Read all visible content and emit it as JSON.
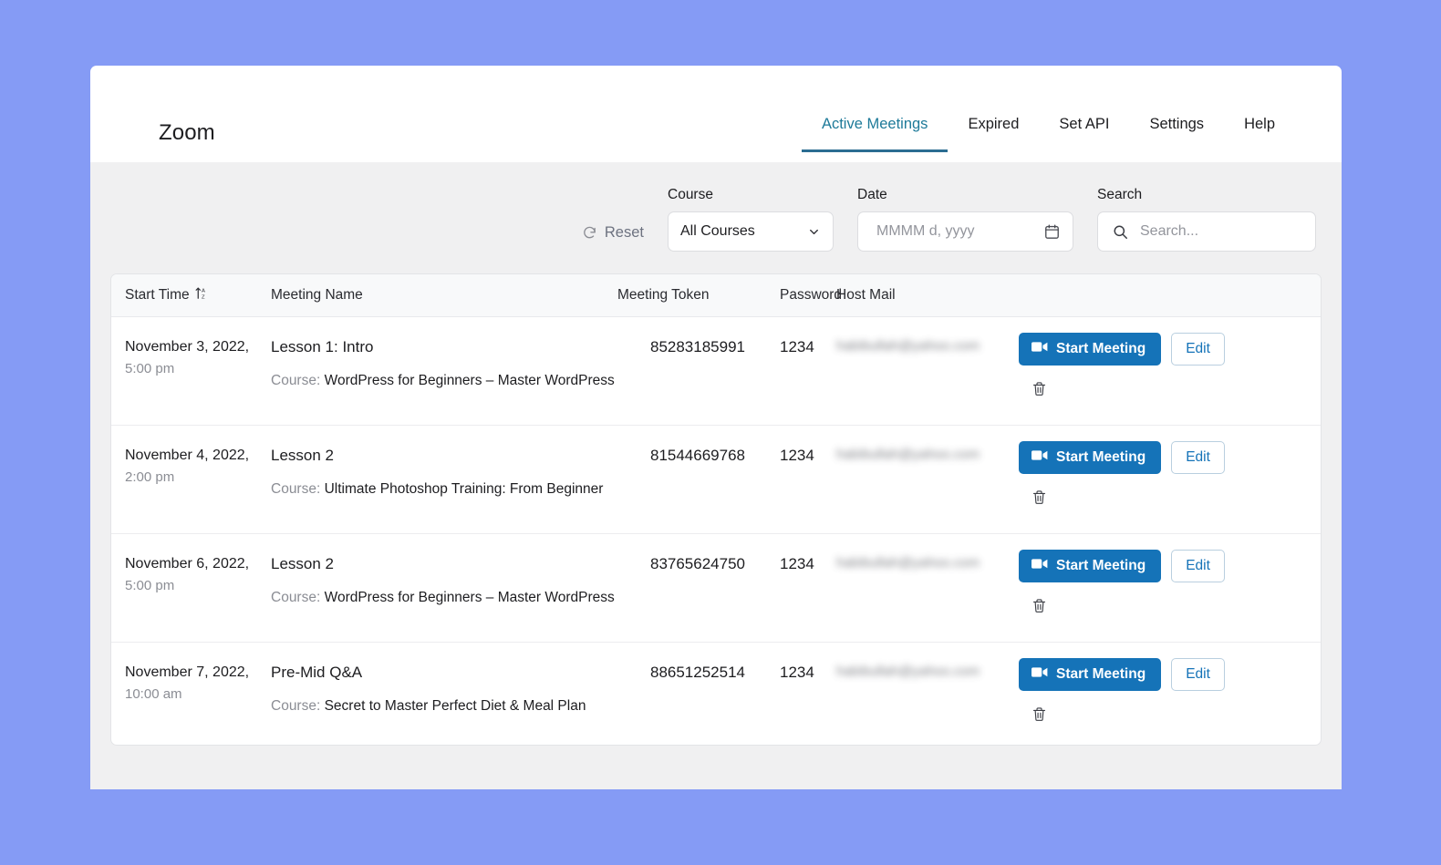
{
  "header": {
    "brand": "Zoom",
    "tabs": [
      {
        "label": "Active Meetings",
        "active": true
      },
      {
        "label": "Expired",
        "active": false
      },
      {
        "label": "Set API",
        "active": false
      },
      {
        "label": "Settings",
        "active": false
      },
      {
        "label": "Help",
        "active": false
      }
    ]
  },
  "filters": {
    "reset_label": "Reset",
    "reset_icon": "refresh-icon",
    "course": {
      "label": "Course",
      "value": "All Courses",
      "icon": "chevron-down-icon",
      "options": [
        "All Courses"
      ]
    },
    "date": {
      "label": "Date",
      "value": "",
      "placeholder": "MMMM d, yyyy",
      "icon": "calendar-icon"
    },
    "search": {
      "label": "Search",
      "value": "",
      "placeholder": "Search...",
      "icon": "search-icon"
    }
  },
  "table": {
    "columns": {
      "start_time": "Start Time",
      "meeting_name": "Meeting Name",
      "meeting_token": "Meeting Token",
      "password": "Password",
      "host_mail": "Host Mail"
    },
    "sort_icon": "sort-az-ascending-icon",
    "course_prefix": "Course:",
    "actions": {
      "start_label": "Start Meeting",
      "start_icon": "video-camera-icon",
      "edit_label": "Edit",
      "delete_icon": "trash-icon"
    },
    "rows": [
      {
        "date": "November 3, 2022,",
        "time": "5:00 pm",
        "name": "Lesson 1: Intro",
        "course": "WordPress for Beginners – Master WordPress",
        "token": "85283185991",
        "password": "1234",
        "host_mail": "habibullah@yahoo.com"
      },
      {
        "date": "November 4, 2022,",
        "time": "2:00 pm",
        "name": "Lesson 2",
        "course": "Ultimate Photoshop Training: From Beginner",
        "token": "81544669768",
        "password": "1234",
        "host_mail": "habibullah@yahoo.com"
      },
      {
        "date": "November 6, 2022,",
        "time": "5:00 pm",
        "name": "Lesson 2",
        "course": "WordPress for Beginners – Master WordPress",
        "token": "83765624750",
        "password": "1234",
        "host_mail": "habibullah@yahoo.com"
      },
      {
        "date": "November 7, 2022,",
        "time": "10:00 am",
        "name": "Pre-Mid Q&A",
        "course": "Secret to Master Perfect Diet & Meal Plan",
        "token": "88651252514",
        "password": "1234",
        "host_mail": "habibullah@yahoo.com"
      }
    ]
  },
  "colors": {
    "page_background": "#859bf5",
    "card_background": "#ffffff",
    "panel_background": "#f0f0f1",
    "accent_primary": "#1573b8",
    "tab_active": "#1e7a99",
    "tab_underline": "#2b6d92",
    "muted_text": "#8b8d94"
  }
}
